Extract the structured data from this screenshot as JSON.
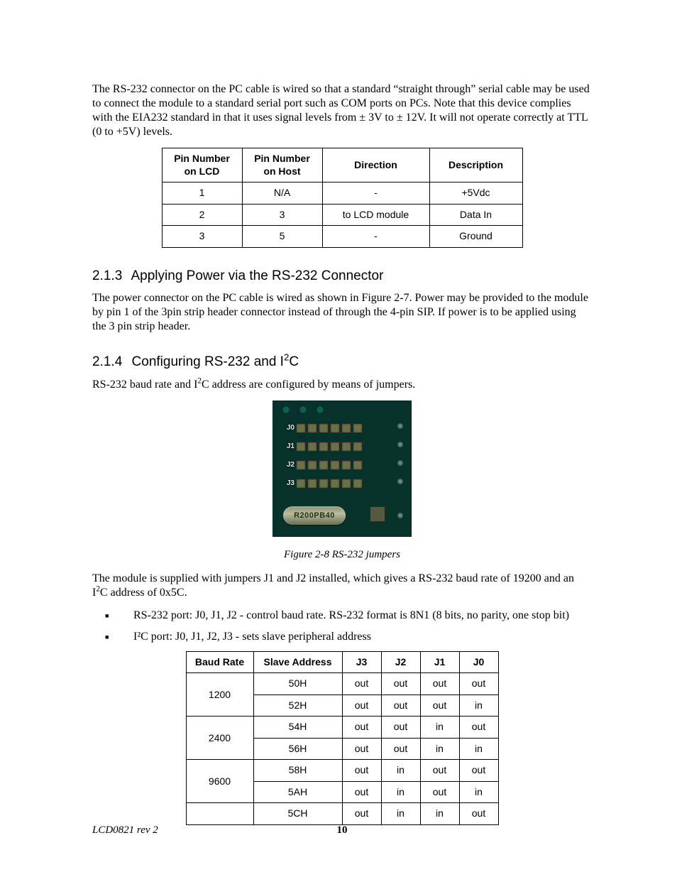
{
  "paragraphs": {
    "intro": "The RS-232 connector on the PC cable is wired so that a standard “straight through” serial cable may be used to connect the module to a standard serial port such as COM ports on PCs. Note that this device complies with the EIA232 standard in that it uses signal levels from ± 3V to ± 12V. It will not operate correctly at TTL (0 to +5V) levels.",
    "power": "The power connector on the PC cable is wired as shown in Figure 2-7. Power may be provided to the module by pin 1 of the 3pin strip header connector instead of through the 4-pin SIP. If power is to be applied using the 3 pin strip header.",
    "config_pre": "RS-232 baud rate and I",
    "config_post": "C address are configured by means of jumpers.",
    "supplied_pre": "The module is supplied with jumpers J1 and J2 installed, which gives a RS-232 baud rate of 19200 and an I",
    "supplied_post": "C address of 0x5C."
  },
  "sections": {
    "s213_num": "2.1.3",
    "s213_title": "Applying Power via the RS-232 Connector",
    "s214_num": "2.1.4",
    "s214_title_pre": "Configuring RS-232 and I",
    "s214_title_post": "C"
  },
  "pin_table": {
    "headers": [
      "Pin Number on LCD",
      "Pin Number on Host",
      "Direction",
      "Description"
    ],
    "rows": [
      [
        "1",
        "N/A",
        "-",
        "+5Vdc"
      ],
      [
        "2",
        "3",
        "to LCD module",
        "Data In"
      ],
      [
        "3",
        "5",
        "-",
        "Ground"
      ]
    ]
  },
  "figure": {
    "caption": "Figure 2-8 RS-232 jumpers",
    "jumper_labels": [
      "J0",
      "J1",
      "J2",
      "J3"
    ],
    "chip_label": "R200PB40"
  },
  "bullets": [
    "RS-232 port:  J0, J1, J2 -  control baud rate. RS-232 format is 8N1 (8 bits, no parity, one stop bit)",
    "I²C port:  J0, J1, J2, J3 - sets slave peripheral address"
  ],
  "jumper_table": {
    "headers": [
      "Baud Rate",
      "Slave Address",
      "J3",
      "J2",
      "J1",
      "J0"
    ],
    "groups": [
      {
        "baud": "1200",
        "rows": [
          {
            "addr": "50H",
            "j": [
              "out",
              "out",
              "out",
              "out"
            ]
          },
          {
            "addr": "52H",
            "j": [
              "out",
              "out",
              "out",
              "in"
            ]
          }
        ]
      },
      {
        "baud": "2400",
        "rows": [
          {
            "addr": "54H",
            "j": [
              "out",
              "out",
              "in",
              "out"
            ]
          },
          {
            "addr": "56H",
            "j": [
              "out",
              "out",
              "in",
              "in"
            ]
          }
        ]
      },
      {
        "baud": "9600",
        "rows": [
          {
            "addr": "58H",
            "j": [
              "out",
              "in",
              "out",
              "out"
            ]
          },
          {
            "addr": "5AH",
            "j": [
              "out",
              "in",
              "out",
              "in"
            ]
          }
        ]
      },
      {
        "baud": "",
        "rows": [
          {
            "addr": "5CH",
            "j": [
              "out",
              "in",
              "in",
              "out"
            ]
          }
        ]
      }
    ]
  },
  "footer": {
    "docid": "LCD0821 rev 2",
    "page": "10"
  }
}
